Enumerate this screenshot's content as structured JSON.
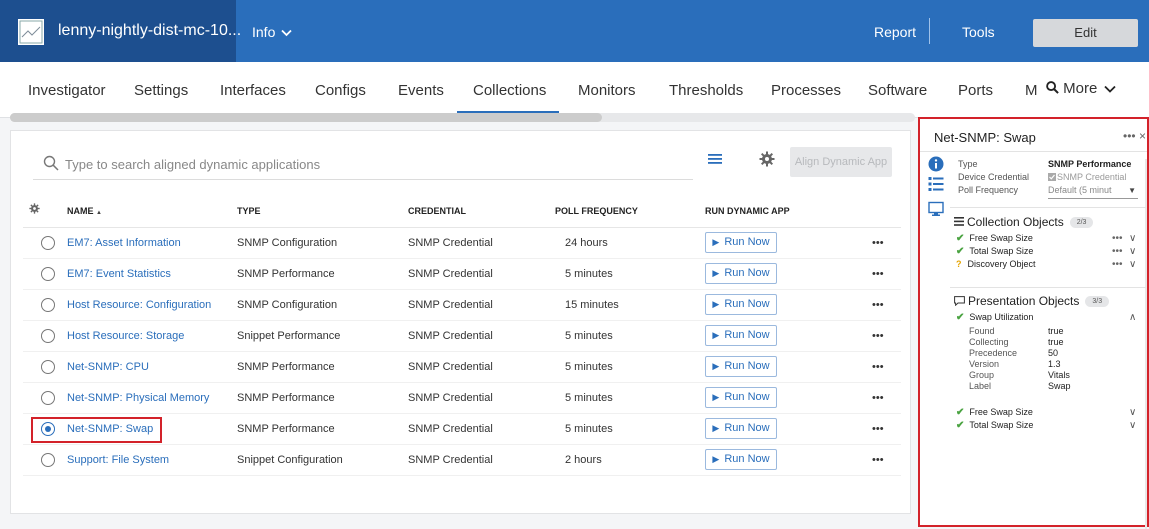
{
  "header": {
    "device_name": "lenny-nightly-dist-mc-10...",
    "info_label": "Info",
    "report_label": "Report",
    "tools_label": "Tools",
    "edit_label": "Edit",
    "colors": {
      "bar": "#2a6ebb",
      "device_block": "#1d4f8f"
    }
  },
  "tabs": {
    "items": [
      "Investigator",
      "Settings",
      "Interfaces",
      "Configs",
      "Events",
      "Collections",
      "Monitors",
      "Thresholds",
      "Processes",
      "Software",
      "Ports",
      "M"
    ],
    "active": "Collections",
    "more_label": "More"
  },
  "toolbar": {
    "search_placeholder": "Type to search aligned dynamic applications",
    "align_label": "Align Dynamic App"
  },
  "table": {
    "columns": {
      "name": "NAME",
      "type": "TYPE",
      "credential": "CREDENTIAL",
      "poll": "POLL FREQUENCY",
      "run": "RUN DYNAMIC APP"
    },
    "sort_indicator": "▲",
    "run_label": "Run Now",
    "row_menu": "•••",
    "rows": [
      {
        "name": "EM7: Asset Information",
        "type": "SNMP Configuration",
        "credential": "SNMP Credential",
        "poll": "24 hours",
        "selected": false
      },
      {
        "name": "EM7: Event Statistics",
        "type": "SNMP Performance",
        "credential": "SNMP Credential",
        "poll": "5 minutes",
        "selected": false
      },
      {
        "name": "Host Resource: Configuration",
        "type": "SNMP Configuration",
        "credential": "SNMP Credential",
        "poll": "15 minutes",
        "selected": false
      },
      {
        "name": "Host Resource: Storage",
        "type": "Snippet Performance",
        "credential": "SNMP Credential",
        "poll": "5 minutes",
        "selected": false
      },
      {
        "name": "Net-SNMP: CPU",
        "type": "SNMP Performance",
        "credential": "SNMP Credential",
        "poll": "5 minutes",
        "selected": false
      },
      {
        "name": "Net-SNMP: Physical Memory",
        "type": "SNMP Performance",
        "credential": "SNMP Credential",
        "poll": "5 minutes",
        "selected": false
      },
      {
        "name": "Net-SNMP: Swap",
        "type": "SNMP Performance",
        "credential": "SNMP Credential",
        "poll": "5 minutes",
        "selected": true
      },
      {
        "name": "Support: File System",
        "type": "Snippet Configuration",
        "credential": "SNMP Credential",
        "poll": "2 hours",
        "selected": false
      }
    ]
  },
  "detail": {
    "title": "Net-SNMP: Swap",
    "actions": "••• ×",
    "type_label": "Type",
    "type_value": "SNMP Performance",
    "credential_label": "Device Credential",
    "credential_value": "SNMP Credential",
    "poll_label": "Poll Frequency",
    "poll_value": "Default (5 minut",
    "collection": {
      "title": "Collection Objects",
      "count": "2/3",
      "items": [
        {
          "label": "Free Swap Size",
          "status": "ok",
          "menu": "•••",
          "caret": "∨"
        },
        {
          "label": "Total Swap Size",
          "status": "ok",
          "menu": "•••",
          "caret": "∨"
        },
        {
          "label": "Discovery Object",
          "status": "unknown",
          "menu": "•••",
          "caret": "∨"
        }
      ]
    },
    "presentation": {
      "title": "Presentation Objects",
      "count": "3/3",
      "expanded": {
        "label": "Swap Utilization",
        "caret": "∧",
        "fields": [
          {
            "key": "Found",
            "value": "true"
          },
          {
            "key": "Collecting",
            "value": "true"
          },
          {
            "key": "Precedence",
            "value": "50"
          },
          {
            "key": "Version",
            "value": "1.3"
          },
          {
            "key": "Group",
            "value": "Vitals"
          },
          {
            "key": "Label",
            "value": "Swap"
          }
        ]
      },
      "items": [
        {
          "label": "Free Swap Size",
          "caret": "∨"
        },
        {
          "label": "Total Swap Size",
          "caret": "∨"
        }
      ]
    }
  }
}
